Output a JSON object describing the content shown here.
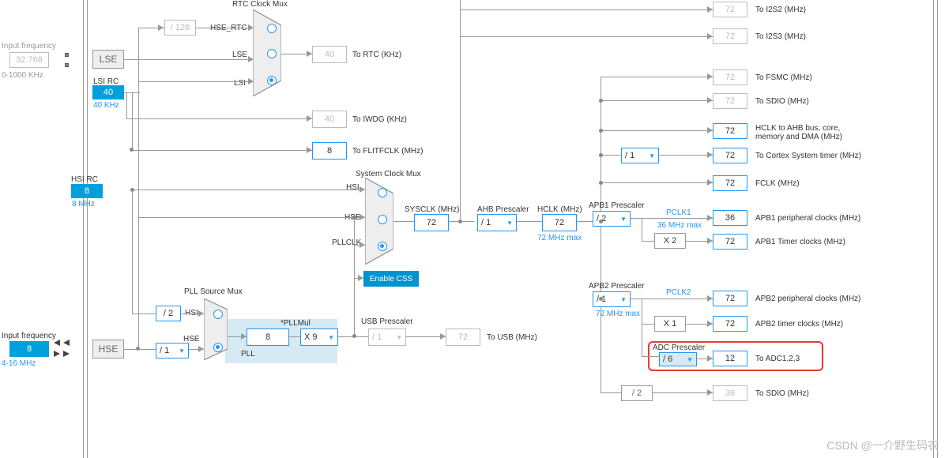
{
  "inputs": {
    "lse_freq_label": "Input frequency",
    "lse_value": "32.768",
    "lse_range": "0-1000 KHz",
    "hse_freq_label": "Input frequency",
    "hse_value": "8",
    "hse_range": "4-16 MHz"
  },
  "sources": {
    "lse": "LSE",
    "lsi_rc": "LSI RC",
    "lsi_value": "40",
    "lsi_unit": "40 KHz",
    "hsi_rc": "HSI RC",
    "hsi_value": "8",
    "hsi_unit": "8 MHz",
    "hse": "HSE"
  },
  "rtc": {
    "title": "RTC Clock Mux",
    "hse_div": "/ 128",
    "hse_rtc": "HSE_RTC",
    "lse": "LSE",
    "lsi": "LSI",
    "rtc_value": "40",
    "rtc_label": "To RTC (KHz)"
  },
  "iwdg": {
    "value": "40",
    "label": "To IWDG (KHz)"
  },
  "flitf": {
    "value": "8",
    "label": "To FLITFCLK (MHz)"
  },
  "sysclk_mux": {
    "title": "System Clock Mux",
    "hsi": "HSI",
    "hse": "HSE",
    "pllclk": "PLLCLK"
  },
  "pll_mux": {
    "title": "PLL Source Mux",
    "hsi": "HSI",
    "hse": "HSE",
    "hsi_div": "/ 2",
    "hse_presc": "/ 1",
    "pll_label": "PLL",
    "pllmul_label": "*PLLMul",
    "pllmul_value": "X 9",
    "pll_value": "8"
  },
  "css": {
    "label": "Enable CSS"
  },
  "sysclk": {
    "label": "SYSCLK (MHz)",
    "value": "72"
  },
  "ahb": {
    "label": "AHB Prescaler",
    "value": "/ 1"
  },
  "hclk": {
    "label": "HCLK (MHz)",
    "value": "72",
    "max": "72 MHz max"
  },
  "usb": {
    "label": "USB Prescaler",
    "value": "/ 1",
    "out": "72",
    "out_label": "To USB (MHz)"
  },
  "apb1": {
    "label": "APB1 Prescaler",
    "value": "/ 2",
    "pclk1": "PCLK1",
    "pclk1_max": "36 MHz max",
    "timer_mul": "X 2",
    "periph_value": "36",
    "periph_label": "APB1 peripheral clocks (MHz)",
    "timer_value": "72",
    "timer_label": "APB1 Timer clocks (MHz)"
  },
  "apb2": {
    "label": "APB2 Prescaler",
    "value": "/ 1",
    "pclk2": "PCLK2",
    "pclk2_max": "72 MHz max",
    "timer_mul": "X 1",
    "periph_value": "72",
    "periph_label": "APB2 peripheral clocks (MHz)",
    "timer_value": "72",
    "timer_label": "APB2 timer clocks (MHz)",
    "adc_label": "ADC Prescaler",
    "adc_presc": "/ 6",
    "adc_value": "12",
    "adc_out_label": "To ADC1,2,3"
  },
  "outputs": {
    "i2s2": {
      "v": "72",
      "l": "To I2S2 (MHz)"
    },
    "i2s3": {
      "v": "72",
      "l": "To I2S3 (MHz)"
    },
    "fsmc": {
      "v": "72",
      "l": "To FSMC (MHz)"
    },
    "sdio": {
      "v": "72",
      "l": "To SDIO (MHz)"
    },
    "hclk_ahb": {
      "v": "72",
      "l": "HCLK to AHB bus, core,",
      "l2": "memory and DMA (MHz)"
    },
    "cortex": {
      "presc": "/ 1",
      "v": "72",
      "l": "To Cortex System timer (MHz)"
    },
    "fclk": {
      "v": "72",
      "l": "FCLK (MHz)"
    },
    "sdio2": {
      "presc": "/ 2",
      "v": "36",
      "l": "To SDIO (MHz)"
    }
  },
  "watermark": "CSDN @一介野生码农"
}
